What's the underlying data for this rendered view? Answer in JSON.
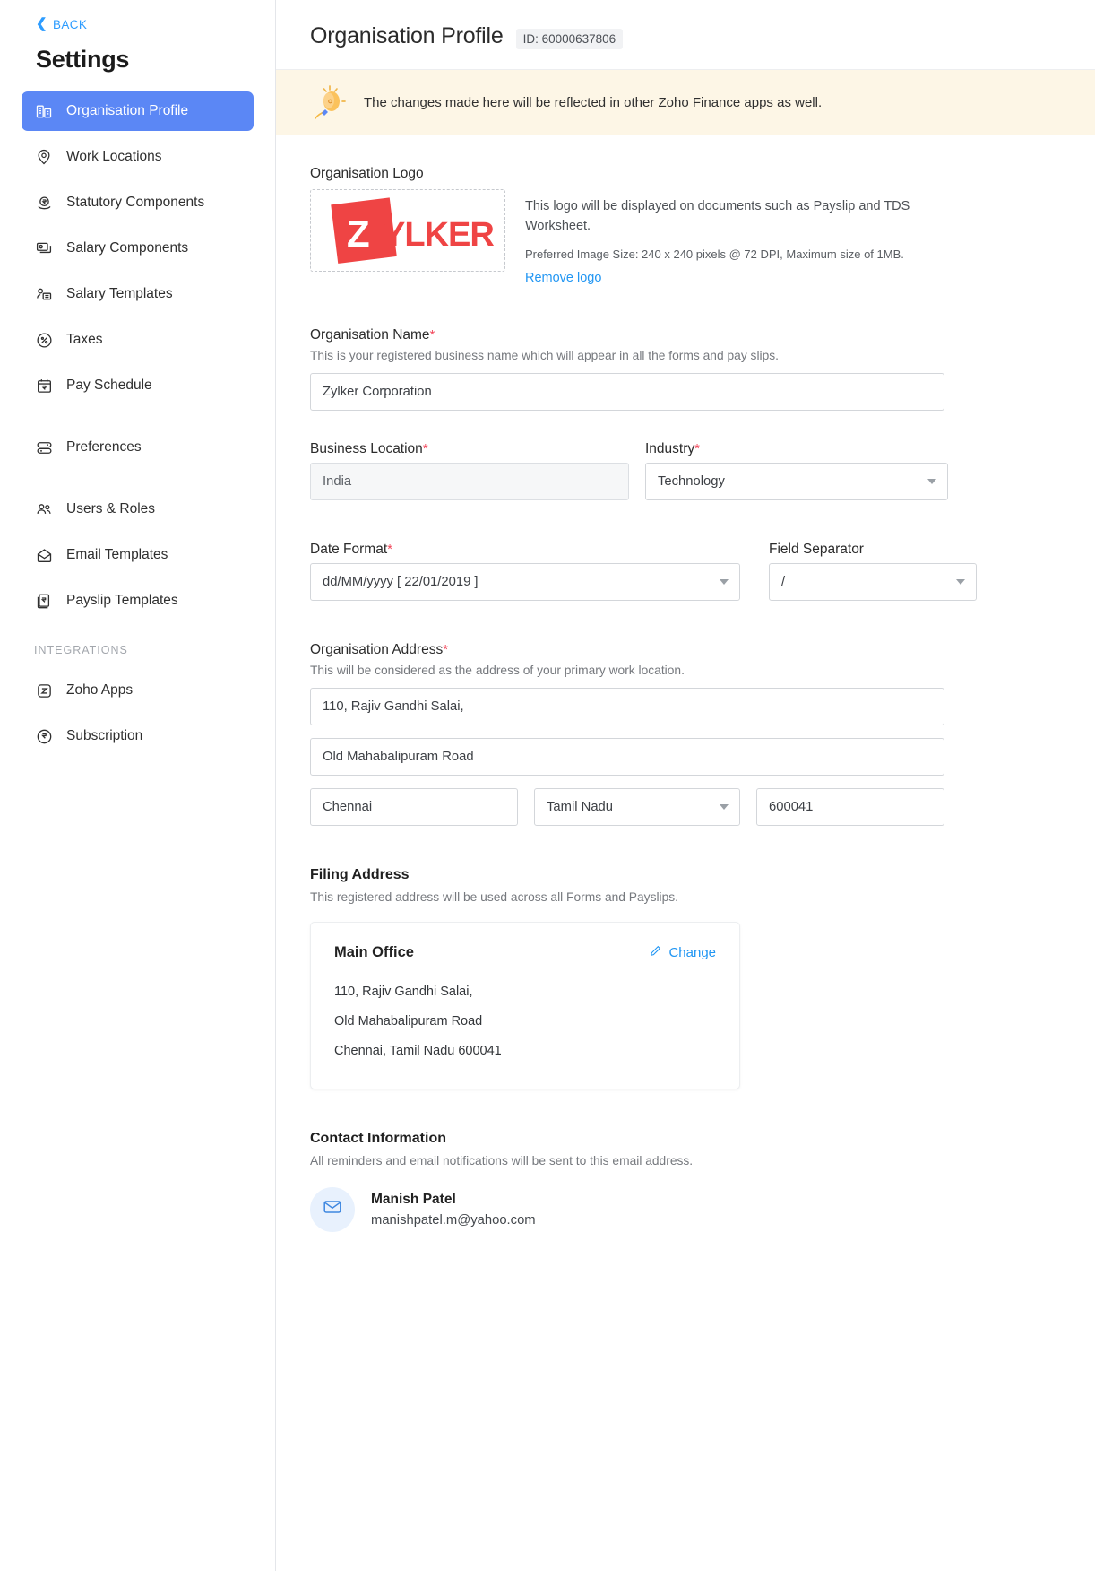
{
  "sidebar": {
    "back_label": "BACK",
    "title": "Settings",
    "items": [
      {
        "label": "Organisation Profile",
        "icon": "building-icon",
        "active": true
      },
      {
        "label": "Work Locations",
        "icon": "location-pin-icon",
        "active": false
      },
      {
        "label": "Statutory Components",
        "icon": "rupee-hand-icon",
        "active": false
      },
      {
        "label": "Salary Components",
        "icon": "money-cards-icon",
        "active": false
      },
      {
        "label": "Salary Templates",
        "icon": "person-template-icon",
        "active": false
      },
      {
        "label": "Taxes",
        "icon": "percent-circle-icon",
        "active": false
      },
      {
        "label": "Pay Schedule",
        "icon": "calendar-rupee-icon",
        "active": false
      },
      {
        "label": "Preferences",
        "icon": "sliders-icon",
        "active": false
      },
      {
        "label": "Users & Roles",
        "icon": "users-icon",
        "active": false
      },
      {
        "label": "Email Templates",
        "icon": "envelope-icon",
        "active": false
      },
      {
        "label": "Payslip Templates",
        "icon": "payslip-rupee-icon",
        "active": false
      }
    ],
    "section_integrations": "INTEGRATIONS",
    "integration_items": [
      {
        "label": "Zoho Apps",
        "icon": "zoho-z-icon"
      },
      {
        "label": "Subscription",
        "icon": "rupee-circle-icon"
      }
    ]
  },
  "header": {
    "title": "Organisation Profile",
    "id_badge": "ID: 60000637806"
  },
  "banner": {
    "icon": "lightbulb-icon",
    "text": "The changes made here will be reflected in other Zoho Finance apps as well."
  },
  "logo_section": {
    "label": "Organisation Logo",
    "logo_text_mark": "Z",
    "logo_text_rest": "YLKER",
    "logo_color": "#ef4444",
    "description": "This logo will be displayed on documents such as Payslip and TDS Worksheet.",
    "size_note": "Preferred Image Size: 240 x 240 pixels @ 72 DPI, Maximum size of 1MB.",
    "remove_link": "Remove logo"
  },
  "org_name": {
    "label": "Organisation Name",
    "required_mark": "*",
    "description": "This is your registered business name which will appear in all the forms and pay slips.",
    "value": "Zylker Corporation",
    "placeholder": "Organisation Name"
  },
  "business_location": {
    "label": "Business Location",
    "required_mark": "*",
    "value": "India"
  },
  "industry": {
    "label": "Industry",
    "required_mark": "*",
    "value": "Technology",
    "icon": "chevron-down-icon"
  },
  "date_format": {
    "label": "Date Format",
    "required_mark": "*",
    "value": "dd/MM/yyyy [ 22/01/2019 ]",
    "icon": "chevron-down-icon"
  },
  "field_separator": {
    "label": "Field Separator",
    "value": "/",
    "icon": "chevron-down-icon"
  },
  "org_address": {
    "label": "Organisation Address",
    "required_mark": "*",
    "description": "This will be considered as the address of your primary work location.",
    "line1": "110, Rajiv Gandhi Salai,",
    "line2": "Old Mahabalipuram Road",
    "city": "Chennai",
    "state": "Tamil Nadu",
    "postal_code": "600041",
    "state_icon": "chevron-down-icon"
  },
  "filing_address": {
    "label": "Filing Address",
    "description": "This registered address will be used across all Forms and Payslips.",
    "card_title": "Main Office",
    "change_label": "Change",
    "change_icon": "pencil-icon",
    "lines": [
      "110, Rajiv Gandhi Salai,",
      "Old Mahabalipuram Road",
      "Chennai, Tamil Nadu 600041"
    ]
  },
  "contact_information": {
    "label": "Contact Information",
    "description": "All reminders and email notifications will be sent to this email address.",
    "avatar_icon": "envelope-icon",
    "name": "Manish Patel",
    "email": "manishpatel.m@yahoo.com"
  },
  "colors": {
    "accent_blue": "#5b87f5",
    "link_blue": "#2196f3",
    "required_red": "#f2475b",
    "banner_bg": "#fdf6e6",
    "logo_red": "#ef4444"
  }
}
